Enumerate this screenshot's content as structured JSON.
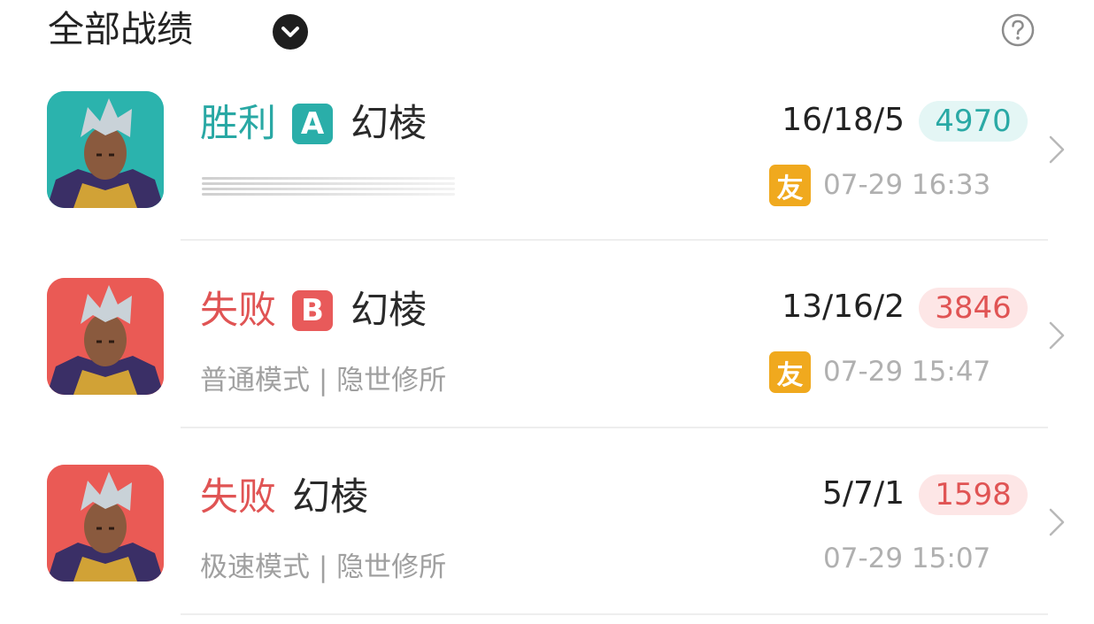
{
  "header": {
    "title": "全部战绩",
    "dropdown_icon": "chevron-down-icon",
    "help_icon": "question-circle-icon"
  },
  "colors": {
    "win": "#29a8a4",
    "lose": "#e05454",
    "friend_badge": "#f0a91e",
    "muted_text": "#a0a0a0"
  },
  "matches": [
    {
      "result": "胜利",
      "outcome": "win",
      "grade": "A",
      "hero": "幻棱",
      "mode": "",
      "kda": "16/18/5",
      "score": "4970",
      "friend_badge": "友",
      "time": "07-29 16:33"
    },
    {
      "result": "失败",
      "outcome": "lose",
      "grade": "B",
      "hero": "幻棱",
      "mode": "普通模式 | 隐世修所",
      "kda": "13/16/2",
      "score": "3846",
      "friend_badge": "友",
      "time": "07-29 15:47"
    },
    {
      "result": "失败",
      "outcome": "lose",
      "grade": "",
      "hero": "幻棱",
      "mode": "极速模式 | 隐世修所",
      "kda": "5/7/1",
      "score": "1598",
      "friend_badge": "",
      "time": "07-29 15:07"
    }
  ]
}
